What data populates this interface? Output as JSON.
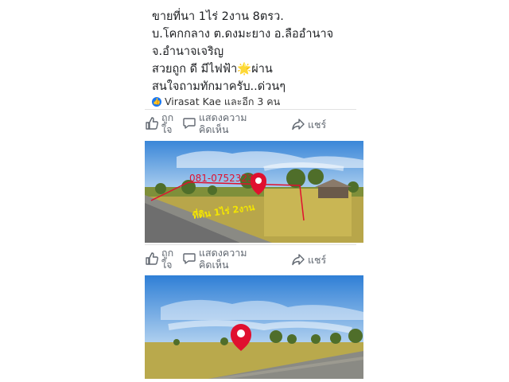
{
  "post": {
    "lines": [
      "ขายที่นา  1ไร่ 2งาน 8ตรว.",
      "บ.โคกกลาง ต.ดงมะยาง อ.ลืออำนาจ",
      "จ.อำนาจเจริญ",
      "สวยถูก ดี มีไฟฟ้า🌟ผ่าน",
      "สนใจถามทักมาครับ..ด่วนๆ"
    ],
    "reactions_text": "Virasat Kae และอีก 3 คน"
  },
  "actions": {
    "like_line1": "ถูก",
    "like_line2": "ใจ",
    "comment_line1": "แสดงความ",
    "comment_line2": "คิดเห็น",
    "share": "แชร์"
  },
  "photo1": {
    "phone": "081-0752323",
    "field_label": "ที่ดิน 1ไร่ 2งาน"
  },
  "icons": [
    "like-icon",
    "comment-icon",
    "share-icon",
    "map-pin-icon"
  ],
  "colors": {
    "pin": "#e0102f",
    "label": "#f4e600",
    "facebook_blue": "#1877f2"
  }
}
